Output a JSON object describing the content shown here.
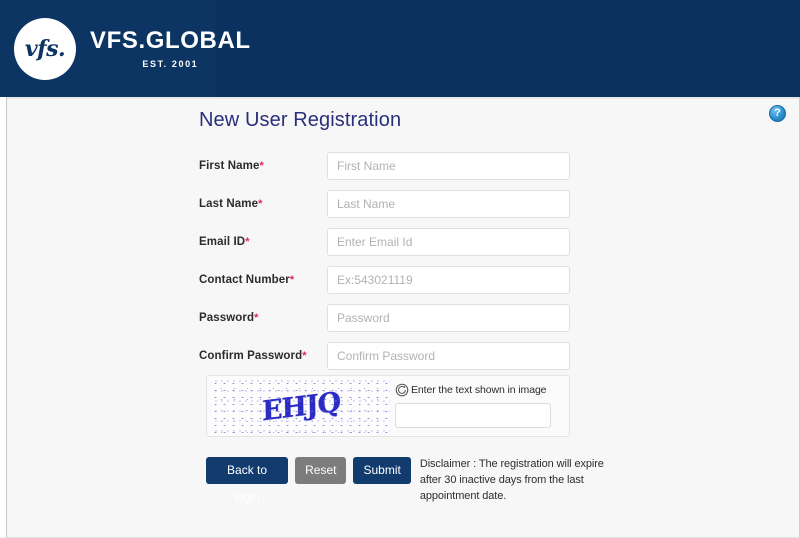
{
  "header": {
    "logo_mark": "vfs.",
    "brand_name": "VFS.GLOBAL",
    "brand_tagline": "EST. 2001",
    "background_color": "#0d3563"
  },
  "content": {
    "help_icon_label": "?",
    "page_title": "New User Registration",
    "title_color": "#2a2f7a"
  },
  "form": {
    "required_marker": "*",
    "fields": [
      {
        "label": "First Name",
        "placeholder": "First Name",
        "value": "",
        "required": true,
        "type": "text"
      },
      {
        "label": "Last Name",
        "placeholder": "Last Name",
        "value": "",
        "required": true,
        "type": "text"
      },
      {
        "label": "Email ID",
        "placeholder": "Enter Email Id",
        "value": "",
        "required": true,
        "type": "text"
      },
      {
        "label": "Contact Number",
        "placeholder": "Ex:543021119",
        "value": "",
        "required": true,
        "type": "text"
      },
      {
        "label": "Password",
        "placeholder": "Password",
        "value": "",
        "required": true,
        "type": "password"
      },
      {
        "label": "Confirm Password",
        "placeholder": "Confirm Password",
        "value": "",
        "required": true,
        "type": "password"
      }
    ]
  },
  "captcha": {
    "image_text": "EHJQ",
    "image_text_color": "#2b2bc4",
    "hint": "Enter the text shown in image",
    "input_value": "",
    "input_placeholder": "",
    "refresh_icon_name": "refresh-icon"
  },
  "actions": {
    "back_to_login_label": "Back to login",
    "reset_label": "Reset",
    "submit_label": "Submit",
    "primary_color": "#123c6e",
    "secondary_color": "#7c7c7c",
    "disclaimer": "Disclaimer : The registration will expire after 30 inactive days from the last appointment date."
  }
}
